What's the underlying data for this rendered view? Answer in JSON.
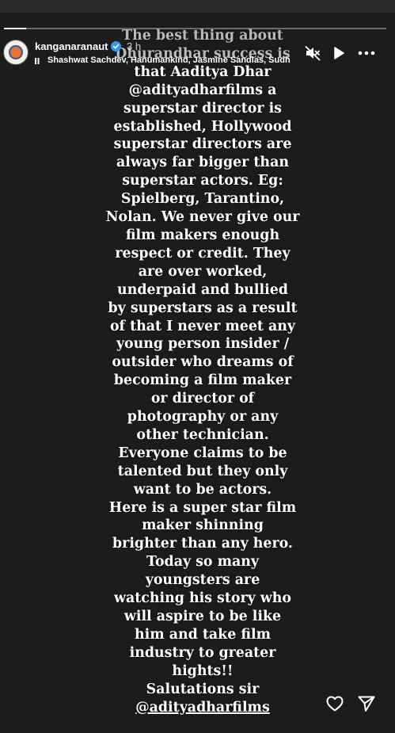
{
  "header": {
    "username": "kanganaranaut",
    "time": "3 h",
    "music": "Shashwat Sachdev, Hanumankind, Jasmine Sandlas, Sudh"
  },
  "story": {
    "lines": [
      "The best thing about",
      "Dhurandhar success is",
      "that  Aaditya Dhar",
      "@adityadharfilms a",
      "superstar director is",
      "established, Hollywood",
      "superstar directors are",
      "always far bigger than",
      "superstar actors. Eg:",
      "Spielberg, Tarantino,",
      "Nolan. We never give our",
      "film makers enough",
      "respect  or credit. They",
      "are over worked,",
      "underpaid and bullied",
      "by superstars as a result",
      "of that I never meet any",
      "young person insider /",
      "outsider who dreams of",
      "becoming a film maker",
      "or director of",
      "photography or any",
      "other technician.",
      "Everyone claims to be",
      "talented but they only",
      "want to be actors.",
      "Here is a super star film",
      "maker shinning",
      "brighter than any hero.",
      "Today so many",
      "youngsters are",
      "watching his story who",
      "will aspire to be like",
      "him and take film",
      "industry to greater",
      "hights!!",
      "Salutations sir",
      "@adityadharfilms"
    ]
  },
  "icons": {
    "mute": "speaker-muted-icon",
    "play": "play-icon",
    "more": "more-icon",
    "like": "heart-icon",
    "share": "send-icon",
    "verified": "verified-badge-icon"
  },
  "colors": {
    "background": "#1c1c1c",
    "verified": "#3897f0"
  }
}
